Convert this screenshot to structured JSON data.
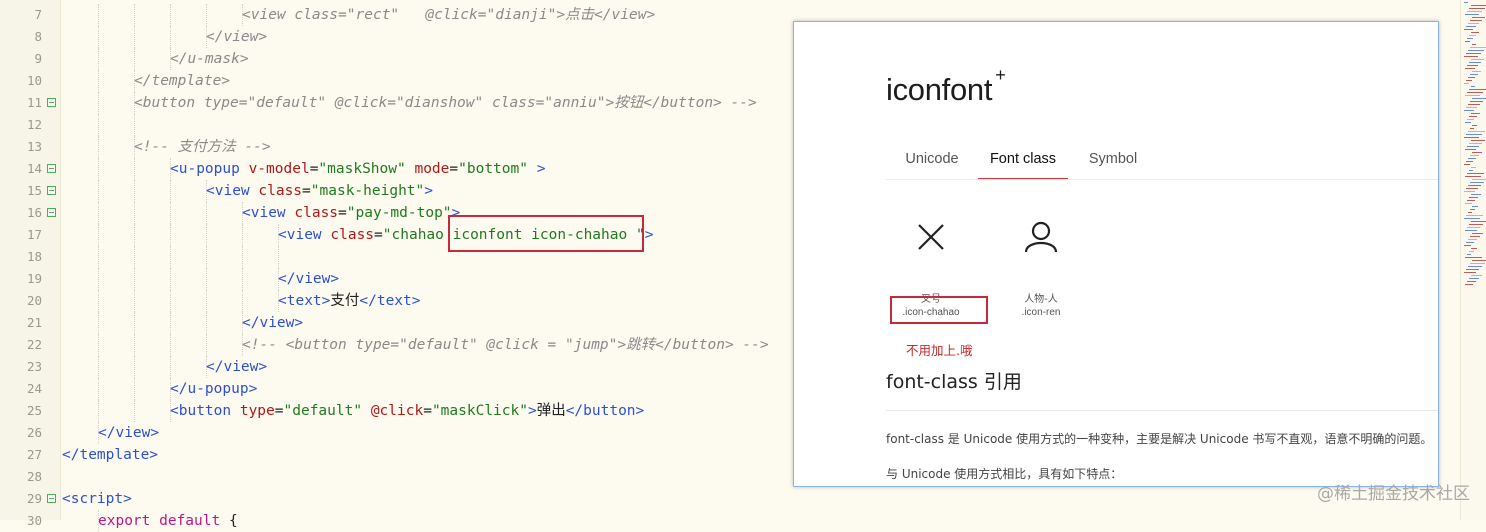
{
  "editor": {
    "lines": [
      {
        "num": "7",
        "fold": false,
        "indent": 5,
        "tokens": [
          [
            "tag",
            "<view "
          ],
          [
            "attr",
            "class"
          ],
          [
            "txt",
            "="
          ],
          [
            "val",
            "\"rect\""
          ],
          [
            "txt",
            "   "
          ],
          [
            "attr",
            "@click"
          ],
          [
            "txt",
            "="
          ],
          [
            "val",
            "\"dianji\""
          ],
          [
            "tag",
            ">"
          ],
          [
            "txt",
            "点击"
          ],
          [
            "tag",
            "</view>"
          ]
        ],
        "comment": true
      },
      {
        "num": "8",
        "fold": false,
        "indent": 4,
        "tokens": [
          [
            "tag",
            "</view>"
          ]
        ],
        "comment": true
      },
      {
        "num": "9",
        "fold": false,
        "indent": 3,
        "tokens": [
          [
            "tag",
            "</u-mask>"
          ]
        ],
        "comment": true
      },
      {
        "num": "10",
        "fold": false,
        "indent": 2,
        "tokens": [
          [
            "tag",
            "</template>"
          ]
        ],
        "comment": true
      },
      {
        "num": "11",
        "fold": true,
        "indent": 2,
        "tokens": [
          [
            "tag",
            "<button "
          ],
          [
            "attr",
            "type"
          ],
          [
            "txt",
            "="
          ],
          [
            "val",
            "\"default\""
          ],
          [
            "txt",
            " "
          ],
          [
            "attr",
            "@click"
          ],
          [
            "txt",
            "="
          ],
          [
            "val",
            "\"dianshow\""
          ],
          [
            "txt",
            " "
          ],
          [
            "attr",
            "class"
          ],
          [
            "txt",
            "="
          ],
          [
            "val",
            "\"anniu\""
          ],
          [
            "tag",
            ">"
          ],
          [
            "txt",
            "按钮"
          ],
          [
            "tag",
            "</button>"
          ],
          [
            "txt",
            " -->"
          ]
        ],
        "comment": true
      },
      {
        "num": "12",
        "fold": false,
        "indent": 2,
        "tokens": [],
        "comment": false
      },
      {
        "num": "13",
        "fold": false,
        "indent": 2,
        "tokens": [
          [
            "com",
            "<!-- 支付方法 -->"
          ]
        ],
        "comment": false
      },
      {
        "num": "14",
        "fold": true,
        "indent": 3,
        "tokens": [
          [
            "tag",
            "<u-popup "
          ],
          [
            "attr",
            "v-model"
          ],
          [
            "txt",
            "="
          ],
          [
            "val",
            "\"maskShow\""
          ],
          [
            "txt",
            " "
          ],
          [
            "attr",
            "mode"
          ],
          [
            "txt",
            "="
          ],
          [
            "val",
            "\"bottom\""
          ],
          [
            "txt",
            " "
          ],
          [
            "tag",
            ">"
          ]
        ],
        "comment": false
      },
      {
        "num": "15",
        "fold": true,
        "indent": 4,
        "tokens": [
          [
            "tag",
            "<view "
          ],
          [
            "attr",
            "class"
          ],
          [
            "txt",
            "="
          ],
          [
            "val",
            "\"mask-height\""
          ],
          [
            "tag",
            ">"
          ]
        ],
        "comment": false
      },
      {
        "num": "16",
        "fold": true,
        "indent": 5,
        "tokens": [
          [
            "tag",
            "<view "
          ],
          [
            "attr",
            "class"
          ],
          [
            "txt",
            "="
          ],
          [
            "val",
            "\"pay-md-top\""
          ],
          [
            "tag",
            ">"
          ]
        ],
        "comment": false
      },
      {
        "num": "17",
        "fold": false,
        "indent": 6,
        "tokens": [
          [
            "tag",
            "<view "
          ],
          [
            "attr",
            "class"
          ],
          [
            "txt",
            "="
          ],
          [
            "val",
            "\"chahao iconfont icon-chahao \""
          ],
          [
            "tag",
            ">"
          ]
        ],
        "comment": false
      },
      {
        "num": "18",
        "fold": false,
        "indent": 6,
        "tokens": [],
        "comment": false
      },
      {
        "num": "19",
        "fold": false,
        "indent": 6,
        "tokens": [
          [
            "tag",
            "</view>"
          ]
        ],
        "comment": false
      },
      {
        "num": "20",
        "fold": false,
        "indent": 6,
        "tokens": [
          [
            "tag",
            "<text>"
          ],
          [
            "txt",
            "支付"
          ],
          [
            "tag",
            "</text>"
          ]
        ],
        "comment": false
      },
      {
        "num": "21",
        "fold": false,
        "indent": 5,
        "tokens": [
          [
            "tag",
            "</view>"
          ]
        ],
        "comment": false
      },
      {
        "num": "22",
        "fold": false,
        "indent": 5,
        "tokens": [
          [
            "com",
            "<!-- <button type=\"default\" @click = \"jump\">跳转</button> -->"
          ]
        ],
        "comment": false
      },
      {
        "num": "23",
        "fold": false,
        "indent": 4,
        "tokens": [
          [
            "tag",
            "</view>"
          ]
        ],
        "comment": false
      },
      {
        "num": "24",
        "fold": false,
        "indent": 3,
        "tokens": [
          [
            "tag",
            "</u-popup>"
          ]
        ],
        "comment": false
      },
      {
        "num": "25",
        "fold": false,
        "indent": 3,
        "tokens": [
          [
            "tag",
            "<button "
          ],
          [
            "attr",
            "type"
          ],
          [
            "txt",
            "="
          ],
          [
            "val",
            "\"default\""
          ],
          [
            "txt",
            " "
          ],
          [
            "attr",
            "@click"
          ],
          [
            "txt",
            "="
          ],
          [
            "val",
            "\"maskClick\""
          ],
          [
            "tag",
            ">"
          ],
          [
            "txt",
            "弹出"
          ],
          [
            "tag",
            "</button>"
          ]
        ],
        "comment": false
      },
      {
        "num": "26",
        "fold": false,
        "indent": 1,
        "tokens": [
          [
            "tag",
            "</view>"
          ]
        ],
        "comment": false
      },
      {
        "num": "27",
        "fold": false,
        "indent": 0,
        "tokens": [
          [
            "tag",
            "</template>"
          ]
        ],
        "comment": false
      },
      {
        "num": "28",
        "fold": false,
        "indent": 0,
        "tokens": [],
        "comment": false
      },
      {
        "num": "29",
        "fold": true,
        "indent": 0,
        "tokens": [
          [
            "tag",
            "<script>"
          ]
        ],
        "comment": false
      },
      {
        "num": "30",
        "fold": false,
        "indent": 1,
        "tokens": [
          [
            "kw",
            "export default"
          ],
          [
            "txt",
            " {"
          ]
        ],
        "comment": false
      }
    ]
  },
  "browser": {
    "logo": "iconfont",
    "logo_mark": "+",
    "tabs": [
      {
        "label": "Unicode",
        "active": false
      },
      {
        "label": "Font class",
        "active": true
      },
      {
        "label": "Symbol",
        "active": false
      }
    ],
    "icons": [
      {
        "name": "叉号",
        "class": ".icon-chahao",
        "glyph": "close-icon"
      },
      {
        "name": "人物-人",
        "class": ".icon-ren",
        "glyph": "person-icon"
      }
    ],
    "note": "不用加上.哦",
    "section_title": "font-class 引用",
    "paragraphs": [
      "font-class 是 Unicode 使用方式的一种变种，主要是解决 Unicode 书写不直观，语意不明确的问题。",
      "与 Unicode 使用方式相比，具有如下特点："
    ]
  },
  "watermark": "@稀土掘金技术社区",
  "colors": {
    "highlight_box": "#c6283c",
    "active_tab": "#d9343a"
  }
}
